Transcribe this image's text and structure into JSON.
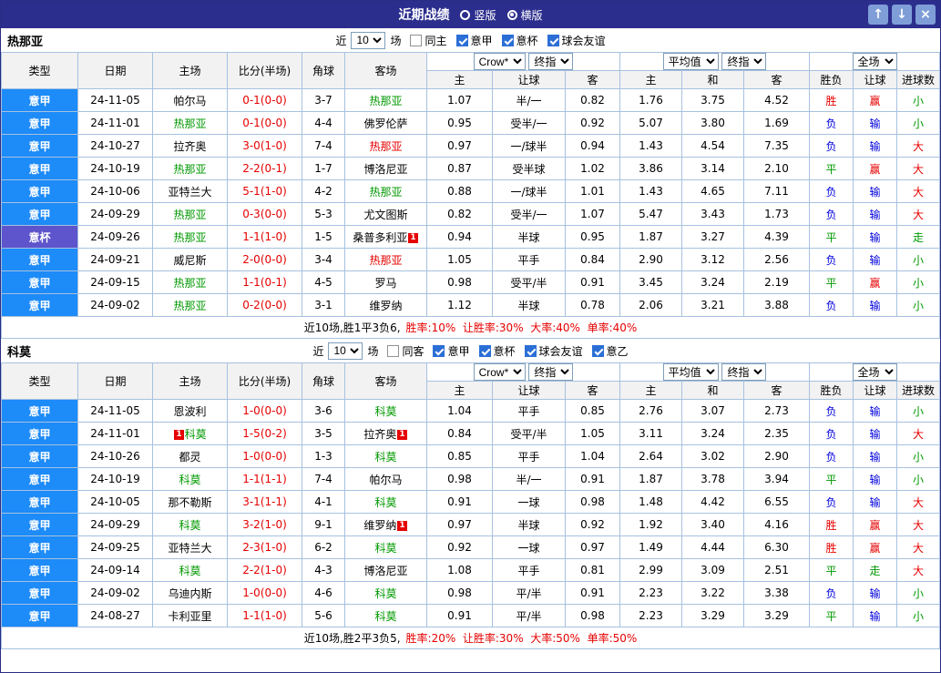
{
  "titlebar": {
    "title": "近期战绩",
    "radio_vertical": "竖版",
    "radio_horizontal": "横版",
    "selected": "横版",
    "up_glyph": "↑",
    "down_glyph": "↓",
    "close_glyph": "×"
  },
  "colors": {
    "titlebar_bg": "#2c2e8e",
    "league_cell_bg": "#1d8bf8",
    "cup_cell_bg": "#5e54cc",
    "team_green": "#009900",
    "win_red": "#e60000",
    "loss_blue": "#0000dd",
    "grid_border": "#a6c1e0",
    "button_bg": "#7f9ed8"
  },
  "sections": [
    {
      "team": "热那亚",
      "filter": {
        "near": "近",
        "games": "10",
        "unit": "场",
        "checkboxes": [
          {
            "label": "同主",
            "checked": false
          },
          {
            "label": "意甲",
            "checked": true
          },
          {
            "label": "意杯",
            "checked": true
          },
          {
            "label": "球会友谊",
            "checked": true
          }
        ]
      },
      "header": {
        "col_type": "类型",
        "col_date": "日期",
        "col_home": "主场",
        "col_score": "比分(半场)",
        "col_corner": "角球",
        "col_away": "客场",
        "dd_crow": "Crow*",
        "dd_final_1": "终指",
        "dd_avg": "平均值",
        "dd_final_2": "终指",
        "dd_full": "全场",
        "sub": [
          "主",
          "让球",
          "客",
          "主",
          "和",
          "客",
          "胜负",
          "让球",
          "进球数"
        ]
      },
      "rows": [
        {
          "type": "意甲",
          "cup": false,
          "date": "24-11-05",
          "home": "帕尔马",
          "homeColor": "black",
          "score": "0-1(0-0)",
          "corner": "3-7",
          "away": "热那亚",
          "awayColor": "green",
          "o1": "1.07",
          "h": "半/一",
          "o2": "0.82",
          "m1": "1.76",
          "m2": "3.75",
          "m3": "4.52",
          "r1": "胜",
          "r2": "赢",
          "r3": "小"
        },
        {
          "type": "意甲",
          "cup": false,
          "date": "24-11-01",
          "home": "热那亚",
          "homeColor": "green",
          "score": "0-1(0-0)",
          "corner": "4-4",
          "away": "佛罗伦萨",
          "awayColor": "black",
          "o1": "0.95",
          "h": "受半/一",
          "o2": "0.92",
          "m1": "5.07",
          "m2": "3.80",
          "m3": "1.69",
          "r1": "负",
          "r2": "输",
          "r3": "小"
        },
        {
          "type": "意甲",
          "cup": false,
          "date": "24-10-27",
          "home": "拉齐奥",
          "homeColor": "black",
          "score": "3-0(1-0)",
          "corner": "7-4",
          "away": "热那亚",
          "awayColor": "red",
          "o1": "0.97",
          "h": "一/球半",
          "o2": "0.94",
          "m1": "1.43",
          "m2": "4.54",
          "m3": "7.35",
          "r1": "负",
          "r2": "输",
          "r3": "大"
        },
        {
          "type": "意甲",
          "cup": false,
          "date": "24-10-19",
          "home": "热那亚",
          "homeColor": "green",
          "score": "2-2(0-1)",
          "corner": "1-7",
          "away": "博洛尼亚",
          "awayColor": "black",
          "o1": "0.87",
          "h": "受半球",
          "o2": "1.02",
          "m1": "3.86",
          "m2": "3.14",
          "m3": "2.10",
          "r1": "平",
          "r2": "赢",
          "r3": "大"
        },
        {
          "type": "意甲",
          "cup": false,
          "date": "24-10-06",
          "home": "亚特兰大",
          "homeColor": "black",
          "score": "5-1(1-0)",
          "corner": "4-2",
          "away": "热那亚",
          "awayColor": "green",
          "o1": "0.88",
          "h": "一/球半",
          "o2": "1.01",
          "m1": "1.43",
          "m2": "4.65",
          "m3": "7.11",
          "r1": "负",
          "r2": "输",
          "r3": "大"
        },
        {
          "type": "意甲",
          "cup": false,
          "date": "24-09-29",
          "home": "热那亚",
          "homeColor": "green",
          "score": "0-3(0-0)",
          "corner": "5-3",
          "away": "尤文图斯",
          "awayColor": "black",
          "o1": "0.82",
          "h": "受半/一",
          "o2": "1.07",
          "m1": "5.47",
          "m2": "3.43",
          "m3": "1.73",
          "r1": "负",
          "r2": "输",
          "r3": "大"
        },
        {
          "type": "意杯",
          "cup": true,
          "date": "24-09-26",
          "home": "热那亚",
          "homeColor": "green",
          "score": "1-1(1-0)",
          "corner": "1-5",
          "away": "桑普多利亚",
          "awayColor": "black",
          "awayBadgeAfter": "1",
          "o1": "0.94",
          "h": "半球",
          "o2": "0.95",
          "m1": "1.87",
          "m2": "3.27",
          "m3": "4.39",
          "r1": "平",
          "r2": "输",
          "r3": "走"
        },
        {
          "type": "意甲",
          "cup": false,
          "date": "24-09-21",
          "home": "威尼斯",
          "homeColor": "black",
          "score": "2-0(0-0)",
          "corner": "3-4",
          "away": "热那亚",
          "awayColor": "red",
          "o1": "1.05",
          "h": "平手",
          "o2": "0.84",
          "m1": "2.90",
          "m2": "3.12",
          "m3": "2.56",
          "r1": "负",
          "r2": "输",
          "r3": "小"
        },
        {
          "type": "意甲",
          "cup": false,
          "date": "24-09-15",
          "home": "热那亚",
          "homeColor": "green",
          "score": "1-1(0-1)",
          "corner": "4-5",
          "away": "罗马",
          "awayColor": "black",
          "o1": "0.98",
          "h": "受平/半",
          "o2": "0.91",
          "m1": "3.45",
          "m2": "3.24",
          "m3": "2.19",
          "r1": "平",
          "r2": "赢",
          "r3": "小"
        },
        {
          "type": "意甲",
          "cup": false,
          "date": "24-09-02",
          "home": "热那亚",
          "homeColor": "green",
          "score": "0-2(0-0)",
          "corner": "3-1",
          "away": "维罗纳",
          "awayColor": "black",
          "o1": "1.12",
          "h": "半球",
          "o2": "0.78",
          "m1": "2.06",
          "m2": "3.21",
          "m3": "3.88",
          "r1": "负",
          "r2": "输",
          "r3": "小"
        }
      ],
      "summary_plain": "近10场,胜1平3负6,",
      "summary_rates": "胜率:10%  让胜率:30%  大率:40%  单率:40%"
    },
    {
      "team": "科莫",
      "filter": {
        "near": "近",
        "games": "10",
        "unit": "场",
        "checkboxes": [
          {
            "label": "同客",
            "checked": false
          },
          {
            "label": "意甲",
            "checked": true
          },
          {
            "label": "意杯",
            "checked": true
          },
          {
            "label": "球会友谊",
            "checked": true
          },
          {
            "label": "意乙",
            "checked": true
          }
        ]
      },
      "header": {
        "col_type": "类型",
        "col_date": "日期",
        "col_home": "主场",
        "col_score": "比分(半场)",
        "col_corner": "角球",
        "col_away": "客场",
        "dd_crow": "Crow*",
        "dd_final_1": "终指",
        "dd_avg": "平均值",
        "dd_final_2": "终指",
        "dd_full": "全场",
        "sub": [
          "主",
          "让球",
          "客",
          "主",
          "和",
          "客",
          "胜负",
          "让球",
          "进球数"
        ]
      },
      "rows": [
        {
          "type": "意甲",
          "cup": false,
          "date": "24-11-05",
          "home": "恩波利",
          "homeColor": "black",
          "score": "1-0(0-0)",
          "corner": "3-6",
          "away": "科莫",
          "awayColor": "green",
          "o1": "1.04",
          "h": "平手",
          "o2": "0.85",
          "m1": "2.76",
          "m2": "3.07",
          "m3": "2.73",
          "r1": "负",
          "r2": "输",
          "r3": "小"
        },
        {
          "type": "意甲",
          "cup": false,
          "date": "24-11-01",
          "home": "科莫",
          "homeColor": "green",
          "homeBadgeBefore": "1",
          "score": "1-5(0-2)",
          "corner": "3-5",
          "away": "拉齐奥",
          "awayColor": "black",
          "awayBadgeAfter": "1",
          "o1": "0.84",
          "h": "受平/半",
          "o2": "1.05",
          "m1": "3.11",
          "m2": "3.24",
          "m3": "2.35",
          "r1": "负",
          "r2": "输",
          "r3": "大"
        },
        {
          "type": "意甲",
          "cup": false,
          "date": "24-10-26",
          "home": "都灵",
          "homeColor": "black",
          "score": "1-0(0-0)",
          "corner": "1-3",
          "away": "科莫",
          "awayColor": "green",
          "o1": "0.85",
          "h": "平手",
          "o2": "1.04",
          "m1": "2.64",
          "m2": "3.02",
          "m3": "2.90",
          "r1": "负",
          "r2": "输",
          "r3": "小"
        },
        {
          "type": "意甲",
          "cup": false,
          "date": "24-10-19",
          "home": "科莫",
          "homeColor": "green",
          "score": "1-1(1-1)",
          "corner": "7-4",
          "away": "帕尔马",
          "awayColor": "black",
          "o1": "0.98",
          "h": "半/一",
          "o2": "0.91",
          "m1": "1.87",
          "m2": "3.78",
          "m3": "3.94",
          "r1": "平",
          "r2": "输",
          "r3": "小"
        },
        {
          "type": "意甲",
          "cup": false,
          "date": "24-10-05",
          "home": "那不勒斯",
          "homeColor": "black",
          "score": "3-1(1-1)",
          "corner": "4-1",
          "away": "科莫",
          "awayColor": "green",
          "o1": "0.91",
          "h": "一球",
          "o2": "0.98",
          "m1": "1.48",
          "m2": "4.42",
          "m3": "6.55",
          "r1": "负",
          "r2": "输",
          "r3": "大"
        },
        {
          "type": "意甲",
          "cup": false,
          "date": "24-09-29",
          "home": "科莫",
          "homeColor": "green",
          "score": "3-2(1-0)",
          "corner": "9-1",
          "away": "维罗纳",
          "awayColor": "black",
          "awayBadgeAfter": "1",
          "o1": "0.97",
          "h": "半球",
          "o2": "0.92",
          "m1": "1.92",
          "m2": "3.40",
          "m3": "4.16",
          "r1": "胜",
          "r2": "赢",
          "r3": "大"
        },
        {
          "type": "意甲",
          "cup": false,
          "date": "24-09-25",
          "home": "亚特兰大",
          "homeColor": "black",
          "score": "2-3(1-0)",
          "corner": "6-2",
          "away": "科莫",
          "awayColor": "green",
          "o1": "0.92",
          "h": "一球",
          "o2": "0.97",
          "m1": "1.49",
          "m2": "4.44",
          "m3": "6.30",
          "r1": "胜",
          "r2": "赢",
          "r3": "大"
        },
        {
          "type": "意甲",
          "cup": false,
          "date": "24-09-14",
          "home": "科莫",
          "homeColor": "green",
          "score": "2-2(1-0)",
          "corner": "4-3",
          "away": "博洛尼亚",
          "awayColor": "black",
          "o1": "1.08",
          "h": "平手",
          "o2": "0.81",
          "m1": "2.99",
          "m2": "3.09",
          "m3": "2.51",
          "r1": "平",
          "r2": "走",
          "r3": "大"
        },
        {
          "type": "意甲",
          "cup": false,
          "date": "24-09-02",
          "home": "乌迪内斯",
          "homeColor": "black",
          "score": "1-0(0-0)",
          "corner": "4-6",
          "away": "科莫",
          "awayColor": "green",
          "o1": "0.98",
          "h": "平/半",
          "o2": "0.91",
          "m1": "2.23",
          "m2": "3.22",
          "m3": "3.38",
          "r1": "负",
          "r2": "输",
          "r3": "小"
        },
        {
          "type": "意甲",
          "cup": false,
          "date": "24-08-27",
          "home": "卡利亚里",
          "homeColor": "black",
          "score": "1-1(1-0)",
          "corner": "5-6",
          "away": "科莫",
          "awayColor": "green",
          "o1": "0.91",
          "h": "平/半",
          "o2": "0.98",
          "m1": "2.23",
          "m2": "3.29",
          "m3": "3.29",
          "r1": "平",
          "r2": "输",
          "r3": "小"
        }
      ],
      "summary_plain": "近10场,胜2平3负5,",
      "summary_rates": "胜率:20%  让胜率:30%  大率:50%  单率:50%"
    }
  ]
}
